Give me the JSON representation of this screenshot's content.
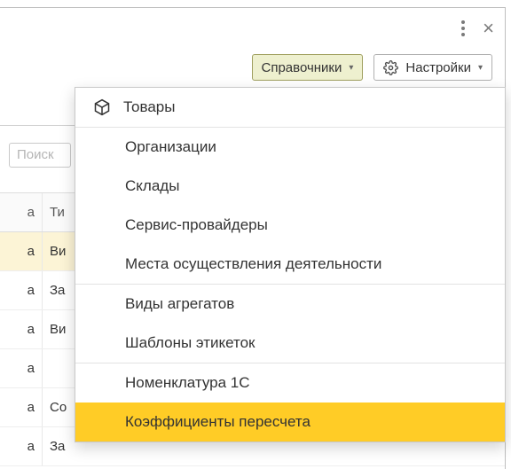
{
  "toolbar": {
    "references_label": "Справочники",
    "settings_label": "Настройки"
  },
  "search": {
    "placeholder": "Поиск"
  },
  "table": {
    "headers": {
      "col1": "а",
      "col2": "Ти"
    },
    "rows": [
      {
        "c1": "а",
        "c2": "Ви",
        "selected": true
      },
      {
        "c1": "а",
        "c2": "За",
        "selected": false
      },
      {
        "c1": "а",
        "c2": "Ви",
        "selected": false
      },
      {
        "c1": "а",
        "c2": "",
        "selected": false
      },
      {
        "c1": "а",
        "c2": "Со",
        "selected": false
      },
      {
        "c1": "а",
        "c2": "За",
        "selected": false
      }
    ]
  },
  "menu": {
    "groups": [
      [
        {
          "label": "Товары",
          "icon": "cube"
        }
      ],
      [
        {
          "label": "Организации"
        },
        {
          "label": "Склады"
        },
        {
          "label": "Сервис-провайдеры"
        },
        {
          "label": "Места осуществления деятельности"
        }
      ],
      [
        {
          "label": "Виды агрегатов"
        },
        {
          "label": "Шаблоны этикеток"
        }
      ],
      [
        {
          "label": "Номенклатура 1С"
        },
        {
          "label": "Коэффициенты пересчета",
          "highlight": true
        }
      ]
    ]
  }
}
